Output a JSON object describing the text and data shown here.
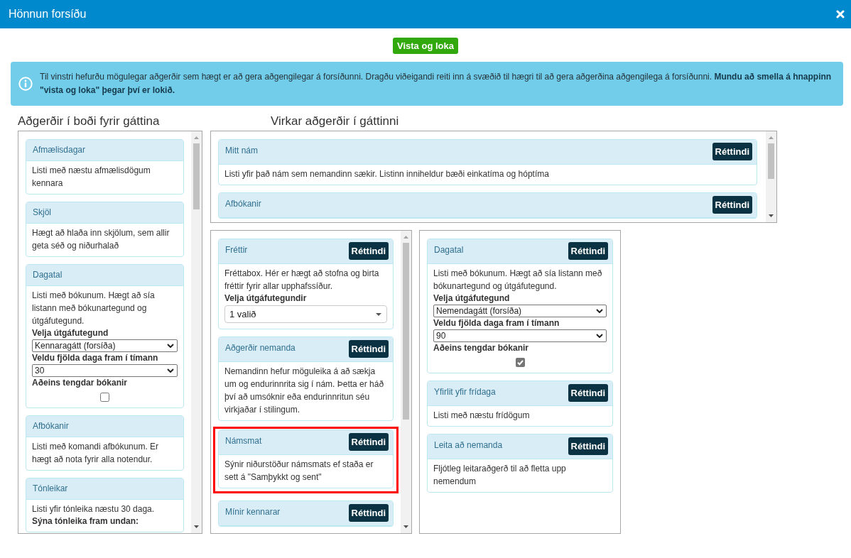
{
  "window": {
    "title": "Hönnun forsíðu"
  },
  "save_button": {
    "label": "Vista og loka"
  },
  "info": {
    "text": "Til vinstri hefurðu mögulegar aðgerðir sem hægt er að gera aðgengilegar á forsíðunni. Dragðu viðeigandi reiti inn á svæðið til hægri til að gera aðgerðina aðgengilega á forsíðunni. **Mundu að smella á hnappinn \"vista og loka\" þegar því er lokið.**"
  },
  "available": {
    "heading": "Aðgerðir í boði fyrir gáttina",
    "scrollable": true,
    "widgets": [
      {
        "title": "Afmælisdagar",
        "description": "Listi með næstu afmælisdögum kennara"
      },
      {
        "title": "Skjöl",
        "description": "Hægt að hlaða inn skjölum, sem allir geta séð og niðurhalað"
      },
      {
        "title": "Dagatal",
        "description": "Listi með bókunum. Hægt að sía listann með bókunartegund og útgáfutegund.",
        "fields": [
          {
            "kind": "select",
            "label": "Velja útgáfutegund",
            "value": "Kennaragátt (forsíða)"
          },
          {
            "kind": "select",
            "label": "Veldu fjölda daga fram í tímann",
            "value": "30"
          },
          {
            "kind": "checkbox",
            "label": "Aðeins tengdar bókanir",
            "checked": false
          }
        ]
      },
      {
        "title": "Afbókanir",
        "description": "Listi með komandi afbókunum. Er hægt að nota fyrir alla notendur."
      },
      {
        "title": "Tónleikar",
        "description": "Listi yfir tónleika næstu 30 daga.",
        "fields": [
          {
            "kind": "label",
            "label": "Sýna tónleika fram undan:"
          }
        ]
      }
    ]
  },
  "active": {
    "heading": "Virkar aðgerðir í gáttinni",
    "top_panel": {
      "scrollable": true,
      "widgets": [
        {
          "title": "Mitt nám",
          "button": "Réttindi",
          "description": "Listi yfir það nám sem nemandinn sækir. Listinn inniheldur bæði einkatíma og hóptíma",
          "highlighted": false
        },
        {
          "title": "Afbókanir",
          "button": "Réttindi",
          "highlighted": false
        }
      ]
    },
    "columns": [
      {
        "scrollable": true,
        "widgets": [
          {
            "title": "Fréttir",
            "button": "Réttindi",
            "description": "Fréttabox. Hér er hægt að stofna og birta fréttir fyrir allar upphafssíður.",
            "fields": [
              {
                "kind": "multiselect",
                "label": "Velja útgáfutegundir",
                "value": "1 valið"
              }
            ],
            "highlighted": false
          },
          {
            "title": "Aðgerðir nemanda",
            "button": "Réttindi",
            "description": "Nemandinn hefur möguleika á að sækja um og endurinnrita sig í nám. Þetta er háð því að umsóknir eða endurinnritun séu virkjaðar í stilingum.",
            "highlighted": false
          },
          {
            "title": "Námsmat",
            "button": "Réttindi",
            "description": "Sýnir niðurstöður námsmats ef staða er sett á \"Samþykkt og sent\"",
            "highlighted": true
          },
          {
            "title": "Mínir kennarar",
            "button": "Réttindi",
            "highlighted": false
          }
        ]
      },
      {
        "scrollable": false,
        "widgets": [
          {
            "title": "Dagatal",
            "button": "Réttindi",
            "description": "Listi með bókunum. Hægt að sía listann með bókunartegund og útgáfutegund.",
            "fields": [
              {
                "kind": "select",
                "label": "Velja útgáfutegund",
                "value": "Nemendagátt (forsíða)"
              },
              {
                "kind": "select",
                "label": "Veldu fjölda daga fram í tímann",
                "value": "90"
              },
              {
                "kind": "checkbox",
                "label": "Aðeins tengdar bókanir",
                "checked": true
              }
            ],
            "highlighted": false
          },
          {
            "title": "Yfirlit yfir frídaga",
            "button": "Réttindi",
            "description": "Listi með næstu frídögum",
            "highlighted": false
          },
          {
            "title": "Leita að nemanda",
            "button": "Réttindi",
            "description": "Fljótleg leitaraðgerð til að fletta upp nemendum",
            "highlighted": false
          }
        ]
      }
    ]
  }
}
